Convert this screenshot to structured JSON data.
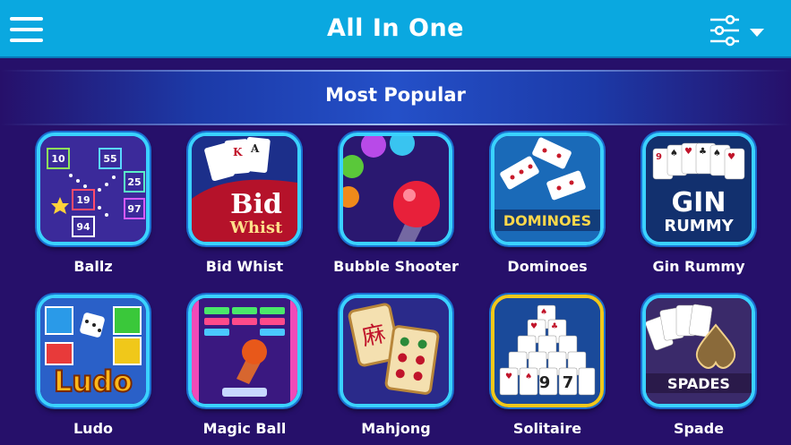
{
  "header": {
    "title": "All In One",
    "menu_icon": "hamburger-menu-icon",
    "filter_icon": "sliders-filter-icon"
  },
  "section": {
    "title": "Most Popular"
  },
  "games": [
    {
      "label": "Ballz",
      "icon": "ballz-icon",
      "tile_text": [
        "10",
        "55",
        "25",
        "19",
        "97",
        "94"
      ]
    },
    {
      "label": "Bid Whist",
      "icon": "bid-whist-icon",
      "tile_text": [
        "Bid",
        "Whist"
      ]
    },
    {
      "label": "Bubble Shooter",
      "icon": "bubble-shooter-icon"
    },
    {
      "label": "Dominoes",
      "icon": "dominoes-icon",
      "tile_text": [
        "DOMINOES"
      ]
    },
    {
      "label": "Gin Rummy",
      "icon": "gin-rummy-icon",
      "tile_text": [
        "GIN",
        "RUMMY"
      ]
    },
    {
      "label": "Ludo",
      "icon": "ludo-icon",
      "tile_text": [
        "Ludo"
      ]
    },
    {
      "label": "Magic Ball",
      "icon": "magic-ball-icon"
    },
    {
      "label": "Mahjong",
      "icon": "mahjong-icon"
    },
    {
      "label": "Solitaire",
      "icon": "solitaire-icon",
      "tile_text": [
        "9",
        "7"
      ]
    },
    {
      "label": "Spade",
      "icon": "spades-icon",
      "tile_text": [
        "SPADES"
      ]
    }
  ],
  "colors": {
    "topbar": "#0aa8e0",
    "background": "#26106a",
    "tile_border": "#3ad2ff"
  }
}
